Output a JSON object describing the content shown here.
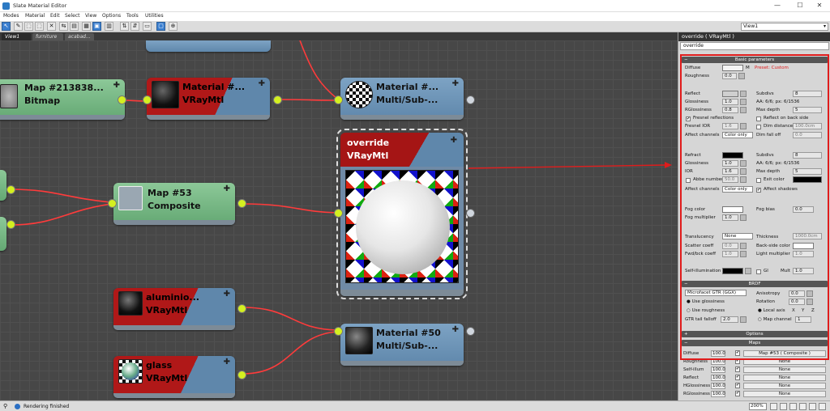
{
  "window": {
    "title": "Slate Material Editor",
    "minimize": "—",
    "maximize": "☐",
    "close": "✕"
  },
  "menu": [
    "Modes",
    "Material",
    "Edit",
    "Select",
    "View",
    "Options",
    "Tools",
    "Utilities"
  ],
  "view_dropdown": "View1",
  "tabs": [
    "View1",
    "furniture",
    "acabad..."
  ],
  "nodes": {
    "bitmap": {
      "title": "Map #213838...",
      "subtitle": "Bitmap"
    },
    "material_vray": {
      "title": "Material #...",
      "subtitle": "VRayMtl"
    },
    "multisub_top": {
      "title": "Material #...",
      "subtitle": "Multi/Sub-..."
    },
    "override": {
      "title": "override",
      "subtitle": "VRayMtl"
    },
    "composite": {
      "title": "Map #53",
      "subtitle": "Composite"
    },
    "aluminio": {
      "title": "aluminio...",
      "subtitle": "VRayMtl"
    },
    "multisub_50": {
      "title": "Material #50",
      "subtitle": "Multi/Sub-..."
    },
    "glass": {
      "title": "glass",
      "subtitle": "VRayMtl"
    }
  },
  "status": {
    "text": "Rendering finished",
    "zoom": "200%"
  },
  "panel": {
    "title": "override ( VRayMtl )",
    "name": "override",
    "basic_header": "Basic parameters",
    "diffuse": "Diffuse",
    "diffuse_m": "M",
    "diffuse_note": "Preset: Custom",
    "roughness": "Roughness",
    "roughness_val": "0.0",
    "reflect": "Reflect",
    "subdivs": "Subdivs",
    "subdivs_val": "8",
    "glossiness": "Glossiness",
    "glossiness_val": "1.0",
    "aa_note": "AA: 6/6; px: 6/1536",
    "rglossiness": "RGlossiness",
    "rglossiness_val": "0.8",
    "max_depth": "Max depth",
    "max_depth_val": "5",
    "fresnel": "Fresnel reflections",
    "reflect_back": "Reflect on back side",
    "fresnel_ior": "Fresnel IOR",
    "fresnel_ior_val": "1.6",
    "dim_distance": "Dim distance",
    "dim_distance_val": "100.0cm",
    "affect_channels": "Affect channels",
    "color_only": "Color only",
    "dim_falloff": "Dim fall off",
    "dim_falloff_val": "0.0",
    "refract": "Refract",
    "refr_subdivs_val": "8",
    "refr_glossiness_val": "1.0",
    "refr_aa_note": "AA: 6/6; px: 6/1536",
    "ior": "IOR",
    "ior_val": "1.6",
    "refr_max_depth_val": "5",
    "abbe": "Abbe number",
    "abbe_val": "50.0",
    "exit_color": "Exit color",
    "affect_shadows": "Affect shadows",
    "fog_color": "Fog color",
    "fog_bias": "Fog bias",
    "fog_bias_val": "0.0",
    "fog_multiplier": "Fog multiplier",
    "fog_multiplier_val": "1.0",
    "translucency": "Translucency",
    "translucency_val": "None",
    "thickness": "Thickness",
    "thickness_val": "1000.0cm",
    "scatter_coeff": "Scatter coeff",
    "scatter_coeff_val": "0.0",
    "back_side_color": "Back-side color",
    "fwd_bck": "Fwd/bck coeff",
    "fwd_bck_val": "1.0",
    "light_multiplier": "Light multiplier",
    "light_multiplier_val": "1.0",
    "self_illum": "Self-illumination",
    "gi": "GI",
    "mult": "Mult",
    "mult_val": "1.0",
    "brdf_header": "BRDF",
    "brdf_type": "Microfacet GTR (GGX)",
    "anisotropy": "Anisotropy",
    "anisotropy_val": "0.0",
    "rotation": "Rotation",
    "rotation_val": "0.0",
    "use_glossiness": "Use glossiness",
    "use_roughness": "Use roughness",
    "local_axis": "Local axis",
    "ax_x": "X",
    "ax_y": "Y",
    "ax_z": "Z",
    "gtr_tail": "GTR tail falloff",
    "gtr_tail_val": "2.0",
    "map_channel": "Map channel",
    "map_channel_val": "1",
    "options_header": "Options",
    "maps_header": "Maps",
    "maps": [
      {
        "name": "Diffuse",
        "amount": "100.0",
        "map": "Map #53 ( Composite )"
      },
      {
        "name": "Roughness",
        "amount": "100.0",
        "map": "None"
      },
      {
        "name": "Self-illum",
        "amount": "100.0",
        "map": "None"
      },
      {
        "name": "Reflect",
        "amount": "100.0",
        "map": "None"
      },
      {
        "name": "HGlossiness",
        "amount": "100.0",
        "map": "None"
      },
      {
        "name": "RGlossiness",
        "amount": "100.0",
        "map": "None"
      }
    ]
  }
}
